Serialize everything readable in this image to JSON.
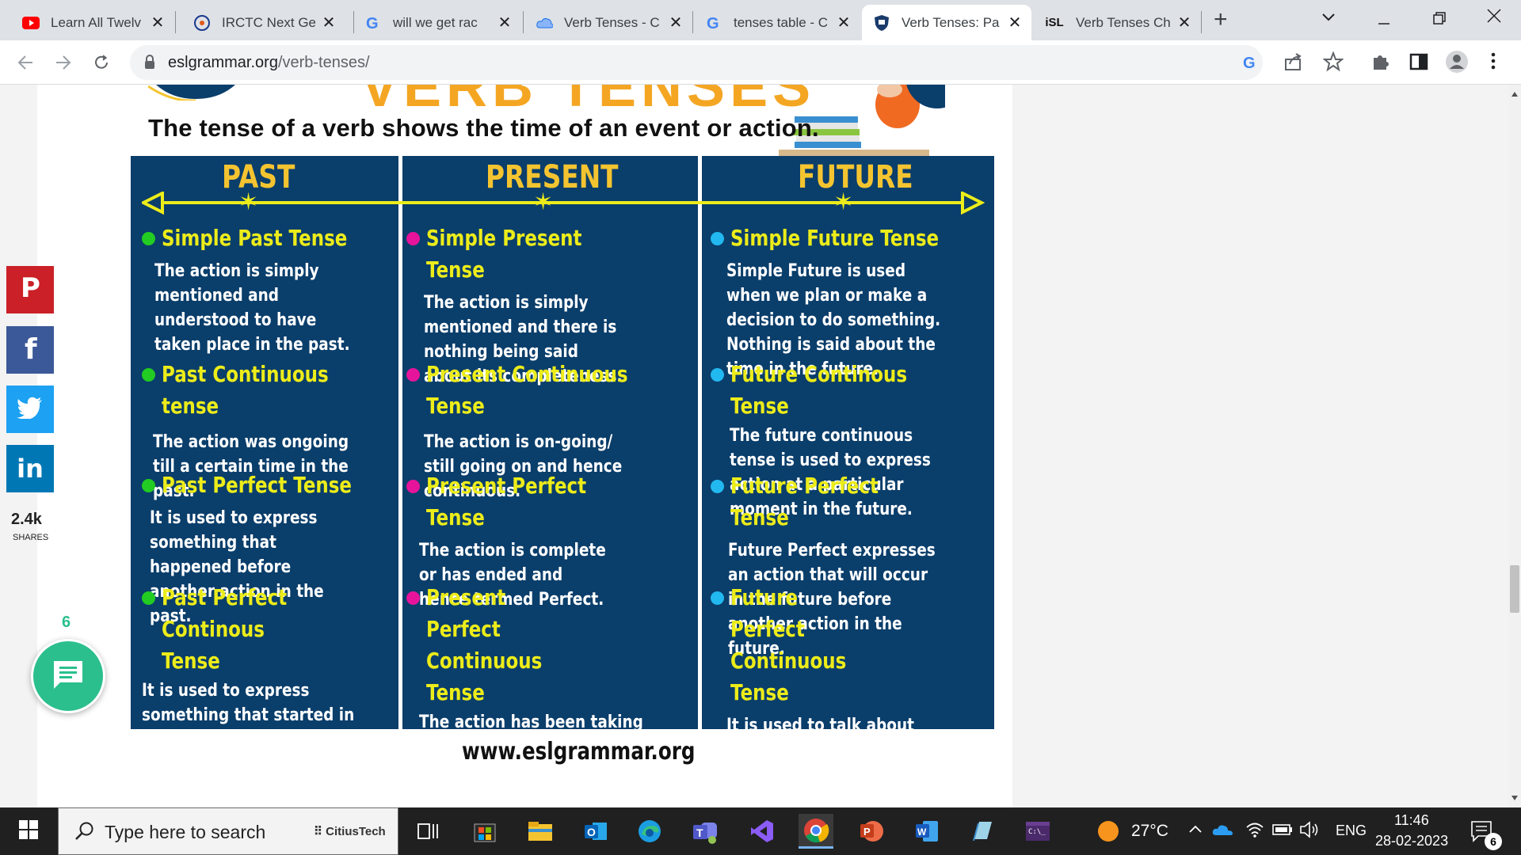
{
  "browser": {
    "tabs": [
      {
        "title": "Learn All Twelv",
        "icon": "youtube-icon"
      },
      {
        "title": "IRCTC Next Ge",
        "icon": "irctc-icon"
      },
      {
        "title": "will we get rac",
        "icon": "google-icon"
      },
      {
        "title": "Verb Tenses - C",
        "icon": "cloud-icon"
      },
      {
        "title": "tenses table - C",
        "icon": "google-icon"
      },
      {
        "title": "Verb Tenses: Pa",
        "icon": "shield-icon",
        "active": true
      },
      {
        "title": "Verb Tenses Ch",
        "icon": "isl-icon",
        "favicon_text": "iSL"
      }
    ],
    "url_host": "eslgrammar.org",
    "url_path": "/verb-tenses/"
  },
  "page": {
    "subtitle": "The tense of a verb shows the time of an event or action.",
    "big_title_fragment": "VERB TENSES",
    "columns": [
      {
        "heading": "PAST",
        "dot": "g",
        "tenses": [
          {
            "name": "Simple Past Tense",
            "desc": "The action is simply mentioned and understood to have taken place in the past."
          },
          {
            "name": "Past Continuous tense",
            "desc": "The action was ongoing till a certain time in the past."
          },
          {
            "name": "Past Perfect Tense",
            "desc": "It is used to express something that happened before another action in the past."
          },
          {
            "name": "Past Perfect Continous Tense",
            "desc": "It is used to express something that started in the past and continued until another time in the past."
          }
        ]
      },
      {
        "heading": "PRESENT",
        "dot": "m",
        "tenses": [
          {
            "name": "Simple Present Tense",
            "desc": "The action is simply mentioned and there is nothing being said about its completeness."
          },
          {
            "name": "Present Continuous Tense",
            "desc": "The action is on-going/ still going on and hence continuous."
          },
          {
            "name": "Present Perfect Tense",
            "desc": "The action is complete or has ended and hence termed Perfect."
          },
          {
            "name": "Present Perfect Continuous Tense",
            "desc": "The action has been taking place for some time and is still ongoing."
          }
        ]
      },
      {
        "heading": "FUTURE",
        "dot": "c",
        "tenses": [
          {
            "name": "Simple Future Tense",
            "desc": "Simple Future is used when we plan or make a decision to do something. Nothing is said about the time in the future."
          },
          {
            "name": "Future Continous Tense",
            "desc": "The future continuous tense is used to express action at a particular moment in the future."
          },
          {
            "name": "Future Perfect Tense",
            "desc": "Future Perfect expresses an action that will occur in the future before another action in the future."
          },
          {
            "name": "Future Perfect Continuous Tense",
            "desc": "It is used to talk about an on-going action before some point in the future."
          }
        ]
      }
    ],
    "site": "www.eslgrammar.org"
  },
  "share": {
    "count": "2.4k",
    "label": "SHARES",
    "chat_count": "6",
    "colors": {
      "pinterest": "#cb2027",
      "facebook": "#3b5998",
      "twitter": "#1da1f2",
      "linkedin": "#0077b5"
    }
  },
  "taskbar": {
    "search_placeholder": "Type here to search",
    "search_logo": "CitiusTech",
    "weather": "27°C",
    "lang": "ENG",
    "time": "11:46",
    "date": "28-02-2023",
    "notifications": "6"
  }
}
